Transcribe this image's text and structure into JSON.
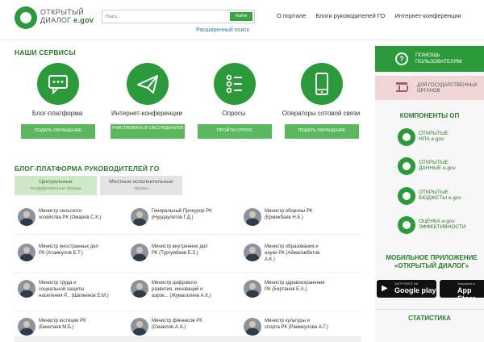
{
  "header": {
    "logo_line1": "ОТКРЫТЫЙ",
    "logo_line2": "ДИАЛОГ",
    "logo_suffix": "e.gov",
    "search_placeholder": "Поиск...",
    "search_button": "Найти",
    "advanced_search": "Расширенный поиск",
    "nav": [
      "О портале",
      "Блоги руководителей ГО",
      "Интернет-конференции"
    ]
  },
  "services": {
    "title": "НАШИ СЕРВИСЫ",
    "items": [
      {
        "label": "Блог-платформа",
        "button": "ПОДАТЬ ОБРАЩЕНИЕ",
        "icon": "chat-bubble-icon"
      },
      {
        "label": "Интернет-конференции",
        "button": "УЧАСТВОВАТЬ В ОБСУЖДЕНИЯХ",
        "icon": "paper-plane-icon"
      },
      {
        "label": "Опросы",
        "button": "ПРОЙТИ ОПРОС",
        "icon": "checklist-icon"
      },
      {
        "label": "Операторы сотовой связи",
        "button": "ПОДАТЬ ОБРАЩЕНИЕ",
        "icon": "mobile-phone-icon"
      }
    ]
  },
  "blog": {
    "title": "БЛОГ-ПЛАТФОРМА РУКОВОДИТЕЛЕЙ ГО",
    "tabs": [
      {
        "label": "Центральные",
        "sub": "государственные органы"
      },
      {
        "label": "Местные исполнительные",
        "sub": "органы"
      }
    ],
    "leaders": [
      {
        "line1": "Министр сельского",
        "line2": "хозяйства РК (Омаров С.К.)",
        "line3": ""
      },
      {
        "line1": "Генеральный Прокурор РК",
        "line2": "(Нурдаулетов Г.Д.)",
        "line3": ""
      },
      {
        "line1": "Министр обороны РК",
        "line2": "(Ермекбаев Н.Б.)",
        "line3": ""
      },
      {
        "line1": "Министр иностранных дел",
        "line2": "РК (Атамкулов Б.Т.)",
        "line3": ""
      },
      {
        "line1": "Министр внутренних дел",
        "line2": "РК (Тургумбаев Е.З.)",
        "line3": ""
      },
      {
        "line1": "Министр образования и",
        "line2": "науки РК (Аймагамбетов",
        "line3": "А.К.)"
      },
      {
        "line1": "Министр труда и",
        "line2": "социальной защиты",
        "line3": "населения Р... (Шапкенов Е.М.)"
      },
      {
        "line1": "Министр цифрового",
        "line2": "развития, инноваций и",
        "line3": "аэрок... (Жумагалиев А.К.)"
      },
      {
        "line1": "Министр здравоохранения",
        "line2": "РК (Биртанов Е.А.)",
        "line3": ""
      },
      {
        "line1": "Министр юстиции РК",
        "line2": "(Бекетаев М.Б.)",
        "line3": ""
      },
      {
        "line1": "Министр финансов РК",
        "line2": "(Смаилов А.А.)",
        "line3": ""
      },
      {
        "line1": "Министр культуры и",
        "line2": "спорта РК (Раимкулова А.Г.)",
        "line3": ""
      }
    ]
  },
  "sidebar": {
    "help_label": "ПОМОЩЬ ПОЛЬЗОВАТЕЛЯМ",
    "gov_label": "ДЛЯ ГОСУДАРСТВЕННЫХ ОРГАНОВ",
    "components_title": "КОМПОНЕНТЫ ОП",
    "components": [
      {
        "line1": "ОТКРЫТЫЕ",
        "line2": "НПА e.gov"
      },
      {
        "line1": "ОТКРЫТЫЕ",
        "line2": "ДАННЫЕ e.gov"
      },
      {
        "line1": "ОТКРЫТЫЕ",
        "line2": "БЮДЖЕТЫ e.gov"
      },
      {
        "line1": "ОЦЕНКА e.gov",
        "line2": "ЭФФЕКТИВНОСТИ"
      }
    ],
    "mobile_title": "МОБИЛЬНОЕ ПРИЛОЖЕНИЕ «ОТКРЫТЫЙ ДИАЛОГ»",
    "google_small": "ЗАГРУЗИТЕ НА",
    "google_big": "Google play",
    "apple_small": "Загрузите в",
    "apple_big": "App Store",
    "stats_title": "СТАТИСТИКА"
  },
  "colors": {
    "brand_green": "#2b9a3a",
    "button_green": "#5bb85e",
    "gov_pink": "#f1d6d8"
  }
}
